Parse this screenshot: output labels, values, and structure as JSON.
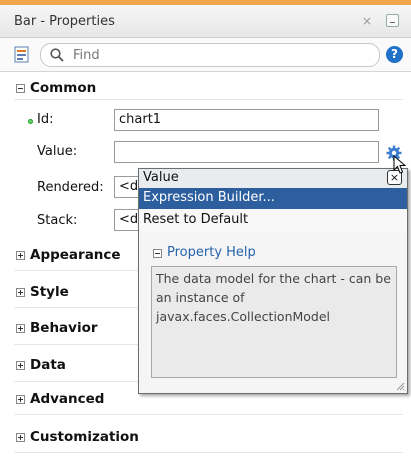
{
  "window": {
    "title": "Bar - Properties",
    "close_glyph": "×"
  },
  "toolbar": {
    "search_placeholder": "Find",
    "help_glyph": "?"
  },
  "sections": {
    "common": "Common",
    "appearance": "Appearance",
    "style": "Style",
    "behavior": "Behavior",
    "data": "Data",
    "advanced": "Advanced",
    "customization": "Customization"
  },
  "properties": {
    "id": {
      "label": "Id:",
      "value": "chart1"
    },
    "value": {
      "label": "Value:",
      "value": ""
    },
    "rendered": {
      "label": "Rendered:",
      "value": "<d"
    },
    "stack": {
      "label": "Stack:",
      "value": "<d"
    }
  },
  "popup": {
    "header": "Value",
    "close_glyph": "×",
    "menu": [
      "Expression Builder...",
      "Reset to Default"
    ],
    "help_title": "Property Help",
    "help_text": "The data model for the chart - can be an instance of javax.faces.CollectionModel"
  },
  "colors": {
    "accent": "#f1a54a",
    "selection": "#2d5f9e",
    "link": "#2563ad"
  },
  "icons": [
    "property-sheet-icon",
    "search-icon",
    "help-icon",
    "gear-icon",
    "close-icon",
    "resize-grip-icon",
    "cursor-icon"
  ]
}
